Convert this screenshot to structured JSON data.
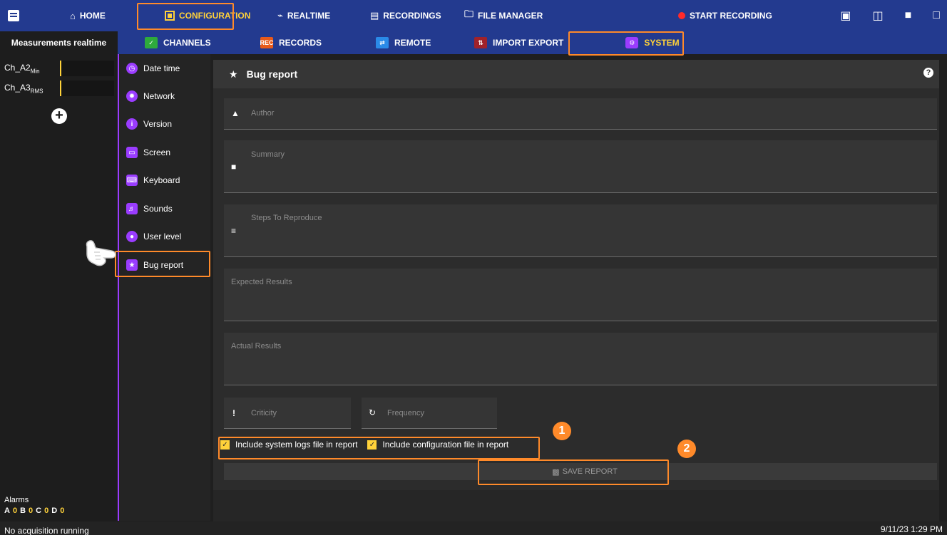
{
  "topnav": {
    "home": "HOME",
    "configuration": "CONFIGURATION",
    "realtime": "REALTIME",
    "recordings": "RECORDINGS",
    "file_manager": "FILE MANAGER",
    "start_recording": "START RECORDING"
  },
  "subnav": {
    "left_title": "Measurements realtime",
    "tabs": [
      "CHANNELS",
      "RECORDS",
      "REMOTE",
      "IMPORT EXPORT",
      "SYSTEM"
    ],
    "records_icon_text": "REC"
  },
  "channels": [
    {
      "base": "Ch_A2",
      "sub": "Min"
    },
    {
      "base": "Ch_A3",
      "sub": "RMS"
    }
  ],
  "system_menu": [
    "Date time",
    "Network",
    "Version",
    "Screen",
    "Keyboard",
    "Sounds",
    "User level",
    "Bug report"
  ],
  "form": {
    "title": "Bug report",
    "author_placeholder": "Author",
    "summary_placeholder": "Summary",
    "steps_placeholder": "Steps To Reproduce",
    "expected_placeholder": "Expected Results",
    "actual_placeholder": "Actual Results",
    "criticity_placeholder": "Criticity",
    "frequency_placeholder": "Frequency",
    "include_logs": "Include system logs file in report",
    "include_config": "Include configuration file in report",
    "save_label": "SAVE REPORT"
  },
  "callouts": [
    "1",
    "2"
  ],
  "alarms": {
    "label": "Alarms",
    "items": [
      {
        "letter": "A",
        "value": "0"
      },
      {
        "letter": "B",
        "value": "0"
      },
      {
        "letter": "C",
        "value": "0"
      },
      {
        "letter": "D",
        "value": "0"
      }
    ]
  },
  "status": {
    "left": "No acquisition running",
    "datetime": "9/11/23 1:29 PM"
  },
  "colors": {
    "nav_blue": "#233a8f",
    "accent_yellow": "#ffd23a",
    "highlight_orange": "#ff8a2a",
    "purple": "#9a3cff"
  }
}
